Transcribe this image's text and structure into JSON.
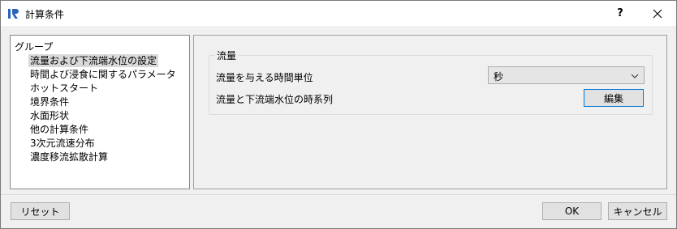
{
  "window": {
    "title": "計算条件",
    "help_label": "?",
    "app_icon": "iric-logo-icon",
    "close_icon": "close-icon"
  },
  "group_tree": {
    "root_label": "グループ",
    "items": [
      {
        "label": "流量および下流端水位の設定",
        "selected": true
      },
      {
        "label": "時間よび浸食に関するパラメータ",
        "selected": false
      },
      {
        "label": "ホットスタート",
        "selected": false
      },
      {
        "label": "境界条件",
        "selected": false
      },
      {
        "label": "水面形状",
        "selected": false
      },
      {
        "label": "他の計算条件",
        "selected": false
      },
      {
        "label": "3次元流速分布",
        "selected": false
      },
      {
        "label": "濃度移流拡散計算",
        "selected": false
      }
    ]
  },
  "flow_group": {
    "title": "流量",
    "time_unit_label": "流量を与える時間単位",
    "time_unit_value": "秒",
    "timeseries_label": "流量と下流端水位の時系列",
    "edit_button": "編集"
  },
  "footer": {
    "reset_button": "リセット",
    "ok_button": "OK",
    "cancel_button": "キャンセル"
  },
  "colors": {
    "accent": "#0078d7",
    "selection": "#d9d9d9"
  }
}
